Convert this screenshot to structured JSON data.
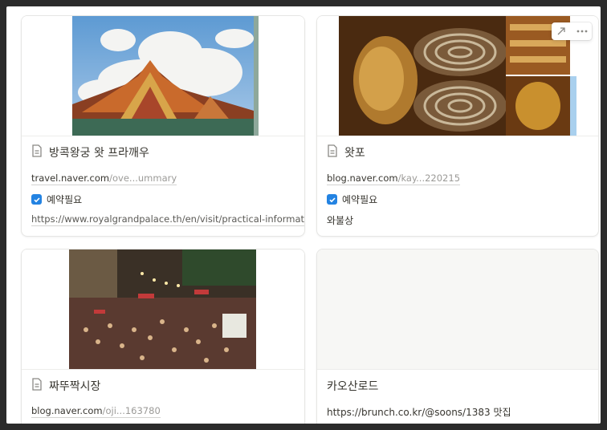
{
  "cards": [
    {
      "title": "방콕왕궁 왓 프라깨우",
      "url_main": "travel.naver.com",
      "url_rest": "/ove...ummary",
      "check_label": "예약필요",
      "link": "https://www.royalgrandpalace.th/en/visit/practical-information"
    },
    {
      "title": "왓포",
      "url_main": "blog.naver.com",
      "url_rest": "/kay...220215",
      "check_label": "예약필요",
      "note": "와불상"
    },
    {
      "title": "짜뚜짝시장",
      "url_main": "blog.naver.com",
      "url_rest": "/oji...163780"
    },
    {
      "title": "카오산로드",
      "note": "https://brunch.co.kr/@soons/1383 맛집"
    }
  ],
  "colors": {
    "checkbox": "#2383e2",
    "text": "#37352f",
    "muted": "#9b9a97"
  },
  "icons": [
    "page-icon",
    "open-icon",
    "more-icon",
    "check-icon"
  ]
}
